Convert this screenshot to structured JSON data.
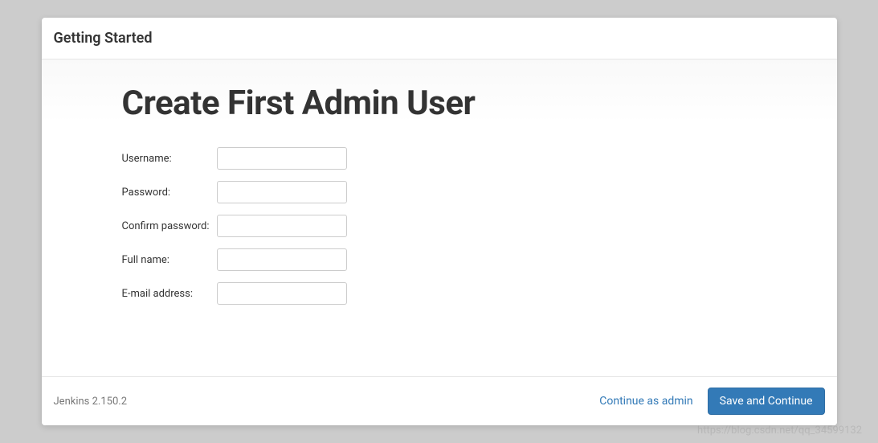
{
  "header": {
    "title": "Getting Started"
  },
  "main": {
    "page_title": "Create First Admin User",
    "form": {
      "fields": [
        {
          "label": "Username:",
          "value": "",
          "type": "text"
        },
        {
          "label": "Password:",
          "value": "",
          "type": "password"
        },
        {
          "label": "Confirm password:",
          "value": "",
          "type": "password"
        },
        {
          "label": "Full name:",
          "value": "",
          "type": "text"
        },
        {
          "label": "E-mail address:",
          "value": "",
          "type": "text"
        }
      ]
    }
  },
  "footer": {
    "version": "Jenkins 2.150.2",
    "continue_as_admin_label": "Continue as admin",
    "save_and_continue_label": "Save and Continue"
  },
  "watermark": "https://blog.csdn.net/qq_34599132"
}
